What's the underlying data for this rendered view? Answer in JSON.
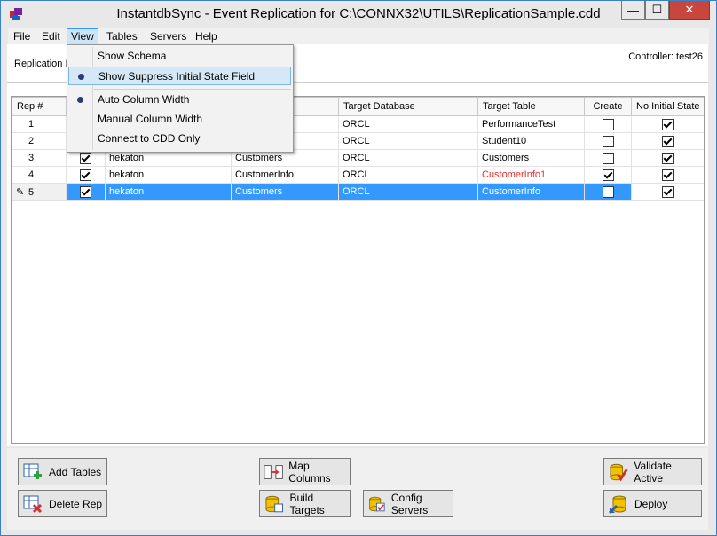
{
  "window": {
    "title": "InstantdbSync - Event Replication for C:\\CONNX32\\UTILS\\ReplicationSample.cdd",
    "minimize": "—",
    "maximize": "☐",
    "close": "✕"
  },
  "menubar": {
    "items": [
      "File",
      "Edit",
      "View",
      "Tables",
      "Servers",
      "Help"
    ]
  },
  "tab": {
    "label": "Replication I"
  },
  "controller": {
    "label": "Controller: test26"
  },
  "view_menu": {
    "items": [
      {
        "label": "Show Schema",
        "checked": false
      },
      {
        "label": "Show Suppress Initial State Field",
        "checked": true
      },
      {
        "label": "Auto Column Width",
        "checked": true
      },
      {
        "label": "Manual Column Width",
        "checked": false
      },
      {
        "label": "Connect to CDD Only",
        "checked": false
      }
    ]
  },
  "grid": {
    "headers": [
      "Rep #",
      "",
      "",
      "",
      "Target Database",
      "Target Table",
      "Create",
      "No Initial State"
    ],
    "rows": [
      {
        "rep": "1",
        "active": true,
        "server": "",
        "source_table": "est",
        "target_db": "ORCL",
        "target_table": "PerformanceTest",
        "create": false,
        "no_initial": true,
        "target_red": false
      },
      {
        "rep": "2",
        "active": true,
        "server": "",
        "source_table": "",
        "target_db": "ORCL",
        "target_table": "Student10",
        "create": false,
        "no_initial": true,
        "target_red": false
      },
      {
        "rep": "3",
        "active": true,
        "server": "hekaton",
        "source_table": "Customers",
        "target_db": "ORCL",
        "target_table": "Customers",
        "create": false,
        "no_initial": true,
        "target_red": false
      },
      {
        "rep": "4",
        "active": true,
        "server": "hekaton",
        "source_table": "CustomerInfo",
        "target_db": "ORCL",
        "target_table": "CustomerInfo1",
        "create": true,
        "no_initial": true,
        "target_red": true
      },
      {
        "rep": "5",
        "active": true,
        "server": "hekaton",
        "source_table": "Customers",
        "target_db": "ORCL",
        "target_table": "CustomerInfo",
        "create": false,
        "no_initial": true,
        "target_red": false,
        "selected": true
      }
    ]
  },
  "buttons": {
    "add_tables": "Add Tables",
    "delete_rep": "Delete Rep",
    "map_columns": "Map Columns",
    "build_targets": "Build Targets",
    "config_servers": "Config Servers",
    "validate_active": "Validate Active",
    "deploy": "Deploy"
  },
  "colors": {
    "selection": "#3399ff",
    "menu_highlight": "#d5e8f7",
    "close_button": "#c7463d",
    "error_text": "#e23030"
  }
}
